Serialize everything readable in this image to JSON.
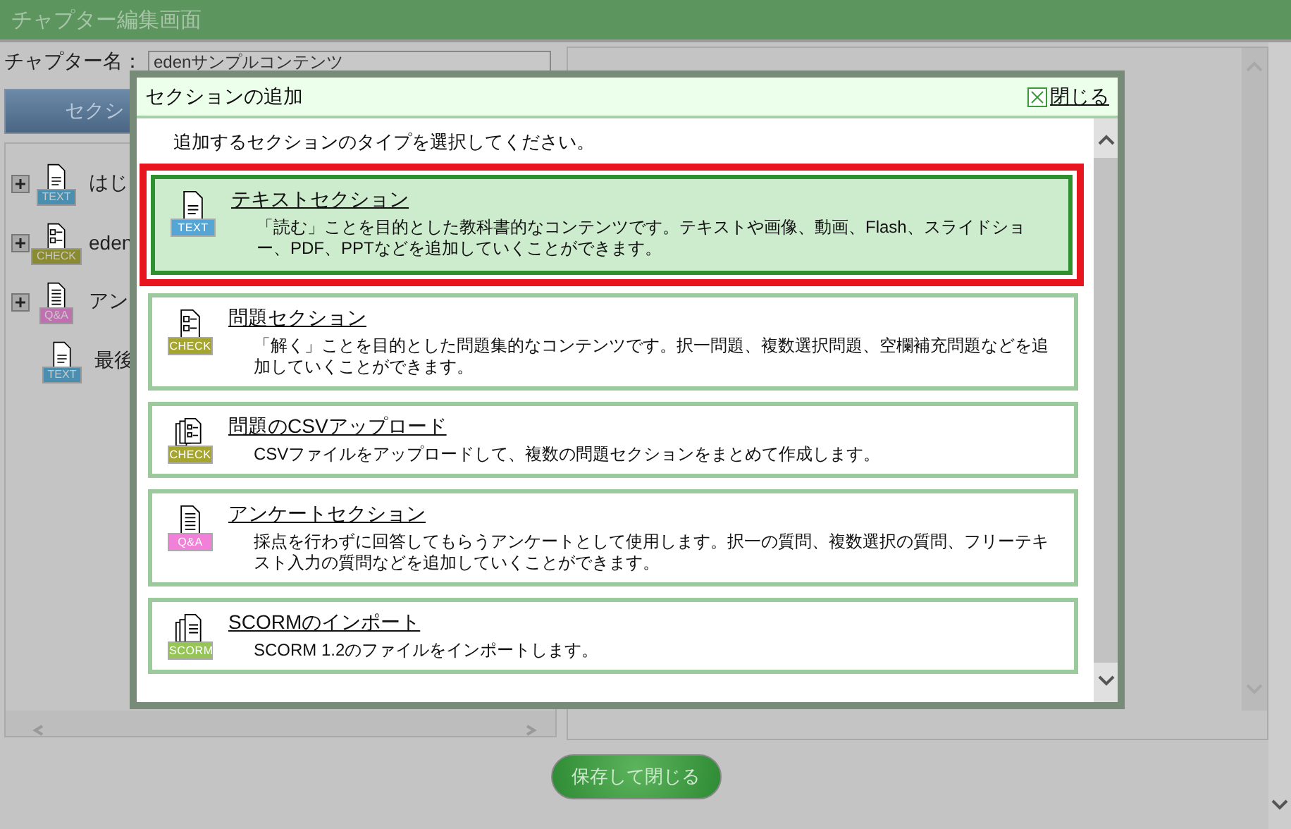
{
  "page": {
    "title": "チャプター編集画面",
    "chapter_name_label": "チャプター名：",
    "chapter_name_value": "edenサンプルコンテンツ",
    "section_button": "セクシ",
    "tree": [
      {
        "badge": "TEXT",
        "color": "#4a8fb0",
        "expandable": true,
        "label": "はじ"
      },
      {
        "badge": "CHECK",
        "color": "#8a8a30",
        "expandable": true,
        "label": "eden"
      },
      {
        "badge": "Q&A",
        "color": "#c070b0",
        "expandable": true,
        "label": "アン"
      },
      {
        "badge": "TEXT",
        "color": "#4a8fb0",
        "expandable": false,
        "label": "最後"
      }
    ],
    "save_button": "保存して閉じる"
  },
  "dialog": {
    "title": "セクションの追加",
    "close": "閉じる",
    "instruction": "追加するセクションのタイプを選択してください。",
    "sections": [
      {
        "kind": "text",
        "badge": "TEXT",
        "color": "#55a5d5",
        "title": "テキストセクション",
        "description": "「読む」ことを目的とした教科書的なコンテンツです。テキストや画像、動画、Flash、スライドショー、PDF、PPTなどを追加していくことができます。",
        "selected": true
      },
      {
        "kind": "check",
        "badge": "CHECK",
        "color": "#a5a530",
        "title": "問題セクション",
        "description": "「解く」ことを目的とした問題集的なコンテンツです。択一問題、複数選択問題、空欄補充問題などを追加していくことができます。",
        "selected": false
      },
      {
        "kind": "csv",
        "badge": "CHECK",
        "color": "#a5a530",
        "title": "問題のCSVアップロード",
        "description": "CSVファイルをアップロードして、複数の問題セクションをまとめて作成します。",
        "selected": false
      },
      {
        "kind": "qa",
        "badge": "Q&A",
        "color": "#f080d8",
        "title": "アンケートセクション",
        "description": "採点を行わずに回答してもらうアンケートとして使用します。択一の質問、複数選択の質問、フリーテキスト入力の質問などを追加していくことができます。",
        "selected": false
      },
      {
        "kind": "scorm",
        "badge": "SCORM",
        "color": "#95c555",
        "title": "SCORMのインポート",
        "description": "SCORM 1.2のファイルをインポートします。",
        "selected": false
      }
    ]
  }
}
